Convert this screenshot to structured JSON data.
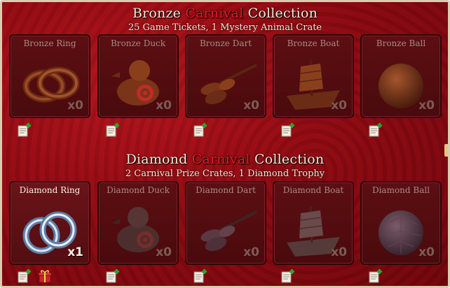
{
  "bronze": {
    "title_pre": "Bronze ",
    "title_accent": "Carnival",
    "title_post": " Collection",
    "reward": "25 Game Tickets, 1 Mystery Animal Crate",
    "items": [
      {
        "name": "Bronze Ring",
        "count": "x0"
      },
      {
        "name": "Bronze Duck",
        "count": "x0"
      },
      {
        "name": "Bronze Dart",
        "count": "x0"
      },
      {
        "name": "Bronze Boat",
        "count": "x0"
      },
      {
        "name": "Bronze Ball",
        "count": "x0"
      }
    ]
  },
  "diamond": {
    "title_pre": "Diamond ",
    "title_accent": "Carnival",
    "title_post": " Collection",
    "reward": "2 Carnival Prize Crates, 1 Diamond Trophy",
    "items": [
      {
        "name": "Diamond Ring",
        "count": "x1"
      },
      {
        "name": "Diamond Duck",
        "count": "x0"
      },
      {
        "name": "Diamond Dart",
        "count": "x0"
      },
      {
        "name": "Diamond Boat",
        "count": "x0"
      },
      {
        "name": "Diamond Ball",
        "count": "x0"
      }
    ]
  },
  "colors": {
    "background": "#8e0a12",
    "accent": "#e41f22",
    "card": "#4a0a0d",
    "text": "#f4ecd8"
  },
  "icons": [
    "scroll-plus-icon",
    "gift-icon"
  ]
}
